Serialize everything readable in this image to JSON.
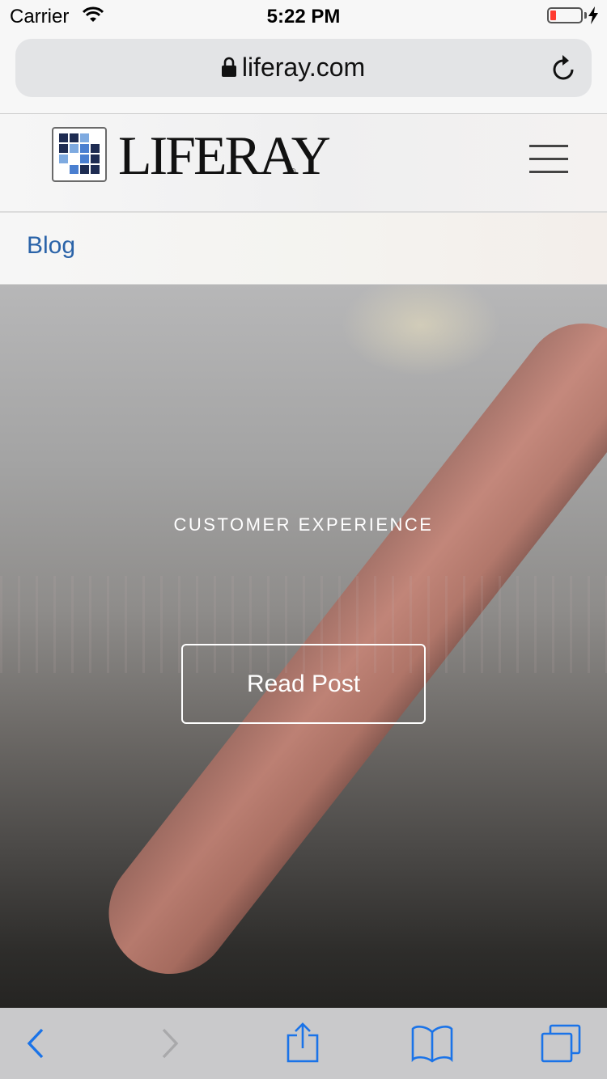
{
  "status_bar": {
    "carrier": "Carrier",
    "time": "5:22 PM",
    "battery_color": "#ff3b30"
  },
  "browser": {
    "url": "liferay.com",
    "accent": "#1a73e8"
  },
  "site": {
    "logo_text": "LIFERAY",
    "logo_registered": "®",
    "brand_colors": [
      "#1e2c52",
      "#4a7fd0",
      "#7eaae0"
    ]
  },
  "breadcrumb": {
    "label": "Blog",
    "color": "#2a63a8"
  },
  "hero": {
    "category": "CUSTOMER EXPERIENCE",
    "cta_label": "Read Post"
  },
  "toolbar": {
    "icons": [
      "back-icon",
      "forward-icon",
      "share-icon",
      "bookmarks-icon",
      "tabs-icon"
    ]
  }
}
